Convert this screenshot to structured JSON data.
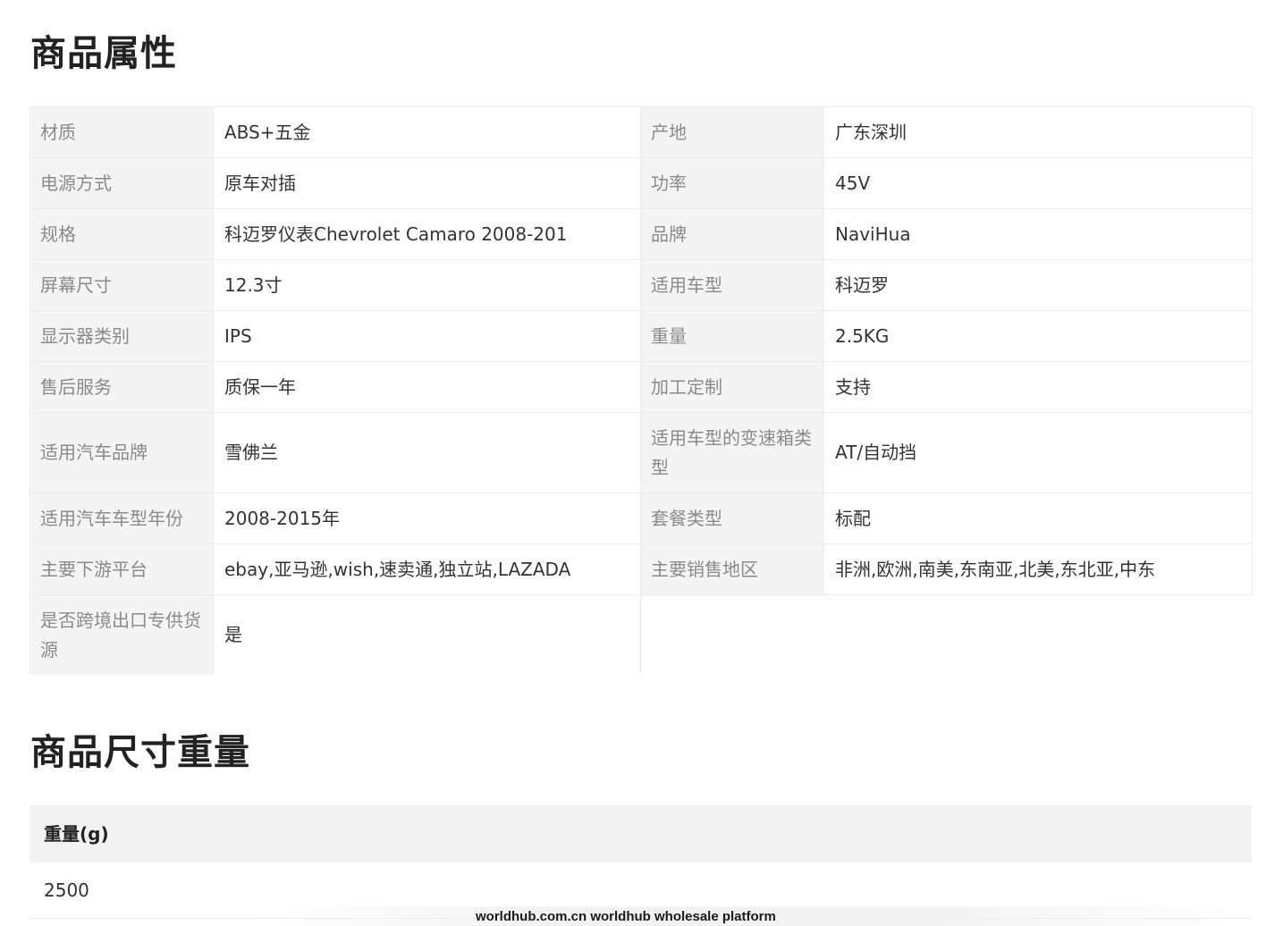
{
  "attributes": {
    "title": "商品属性",
    "rows": [
      {
        "k1": "材质",
        "v1": "ABS+五金",
        "k2": "产地",
        "v2": "广东深圳"
      },
      {
        "k1": "电源方式",
        "v1": "原车对插",
        "k2": "功率",
        "v2": "45V"
      },
      {
        "k1": "规格",
        "v1": "科迈罗仪表Chevrolet Camaro 2008-201",
        "k2": "品牌",
        "v2": "NaviHua"
      },
      {
        "k1": "屏幕尺寸",
        "v1": "12.3寸",
        "k2": "适用车型",
        "v2": "科迈罗"
      },
      {
        "k1": "显示器类别",
        "v1": "IPS",
        "k2": "重量",
        "v2": "2.5KG"
      },
      {
        "k1": "售后服务",
        "v1": "质保一年",
        "k2": "加工定制",
        "v2": "支持"
      },
      {
        "k1": "适用汽车品牌",
        "v1": "雪佛兰",
        "k2": "适用车型的变速箱类型",
        "v2": "AT/自动挡"
      },
      {
        "k1": "适用汽车车型年份",
        "v1": "2008-2015年",
        "k2": "套餐类型",
        "v2": "标配"
      },
      {
        "k1": "主要下游平台",
        "v1": "ebay,亚马逊,wish,速卖通,独立站,LAZADA",
        "k2": "主要销售地区",
        "v2": "非洲,欧洲,南美,东南亚,北美,东北亚,中东"
      },
      {
        "k1": "是否跨境出口专供货源",
        "v1": "是"
      }
    ]
  },
  "size_weight": {
    "title": "商品尺寸重量",
    "header": "重量(g)",
    "value": "2500"
  },
  "watermark": "worldhub.com.cn worldhub wholesale platform"
}
